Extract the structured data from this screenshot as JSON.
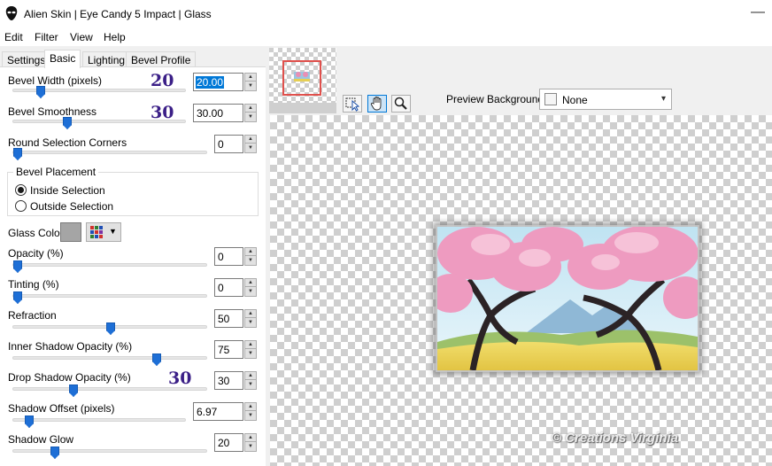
{
  "window": {
    "title": "Alien Skin | Eye Candy 5 Impact | Glass"
  },
  "menu": [
    "Edit",
    "Filter",
    "View",
    "Help"
  ],
  "tabs": [
    "Settings",
    "Basic",
    "Lighting",
    "Bevel Profile"
  ],
  "active_tab": "Basic",
  "controls": {
    "bevel_width": {
      "label": "Bevel Width (pixels)",
      "value": "20.00",
      "annotation": "20",
      "slider": 0.15
    },
    "bevel_smoothness": {
      "label": "Bevel Smoothness",
      "value": "30.00",
      "annotation": "30",
      "slider": 0.3
    },
    "round_corners": {
      "label": "Round Selection Corners",
      "value": "0",
      "slider": 0.0
    },
    "opacity": {
      "label": "Opacity (%)",
      "value": "0",
      "slider": 0.0
    },
    "tinting": {
      "label": "Tinting (%)",
      "value": "0",
      "slider": 0.0
    },
    "refraction": {
      "label": "Refraction",
      "value": "50",
      "slider": 0.5
    },
    "inner_shadow": {
      "label": "Inner Shadow Opacity (%)",
      "value": "75",
      "slider": 0.75
    },
    "drop_shadow": {
      "label": "Drop Shadow Opacity (%)",
      "value": "30",
      "annotation": "30",
      "slider": 0.3
    },
    "shadow_offset": {
      "label": "Shadow Offset (pixels)",
      "value": "6.97",
      "slider": 0.08
    },
    "shadow_glow": {
      "label": "Shadow Glow",
      "value": "20",
      "slider": 0.2
    }
  },
  "bevel_placement": {
    "legend": "Bevel Placement",
    "options": [
      "Inside Selection",
      "Outside Selection"
    ],
    "selected": "Inside Selection"
  },
  "glass_color": {
    "label": "Glass Color",
    "color": "#a5a5a5"
  },
  "preview": {
    "bg_label": "Preview Background:",
    "bg_value": "None",
    "watermark": "© Creations Virginia"
  },
  "colors": {
    "accent": "#1e6fd6",
    "annotation": "#3b1f87",
    "selection": "#0078d7"
  },
  "icons": [
    "alien-skin-icon",
    "close-icon",
    "selection-tool-icon",
    "hand-tool-icon",
    "zoom-tool-icon",
    "chevron-down-icon",
    "color-palette-icon"
  ]
}
